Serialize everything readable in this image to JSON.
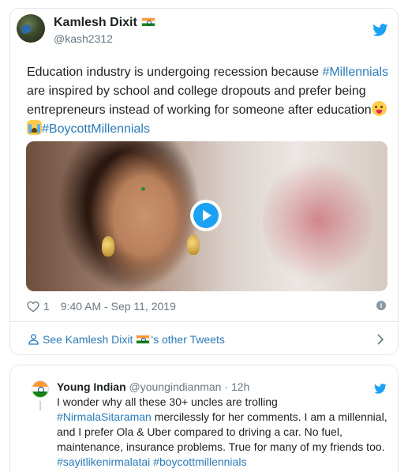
{
  "main_tweet": {
    "author_name": "Kamlesh Dixit",
    "author_handle": "@kash2312",
    "text_part1": "Education industry is undergoing recession because ",
    "hashtag_millennials": "#Millennials",
    "text_part2": " are inspired by school and college dropouts and prefer being entrepreneurs instead of working for someone after education",
    "hashtag_boycott": "#BoycottMillennials",
    "like_count": "1",
    "timestamp": "9:40 AM - Sep 11, 2019",
    "see_other_prefix": "See Kamlesh Dixit",
    "see_other_suffix": "'s other Tweets",
    "info_glyph": "i"
  },
  "reply_tweet": {
    "author_name": "Young Indian",
    "author_handle": "@youngindianman",
    "separator": " · ",
    "age": "12h",
    "line1": "I wonder why all these 30+ uncles are trolling",
    "mention_hashtag": "#NirmalaSitaraman",
    "line2": " mercilessly for her comments. I am a millennial, and I prefer Ola & Uber compared to driving a car. No fuel, maintenance, insurance problems. True for many of my friends too.",
    "hashtags": "#sayitlikenirmalatai #boycottmillennials"
  },
  "colors": {
    "link": "#2b7bb9",
    "twitter_blue": "#1da1f2",
    "muted": "#697882",
    "border": "#e1e8ed"
  },
  "icons": [
    "twitter-bird-icon",
    "heart-icon",
    "info-icon",
    "person-icon",
    "chevron-right-icon",
    "play-icon",
    "india-flag-icon"
  ]
}
